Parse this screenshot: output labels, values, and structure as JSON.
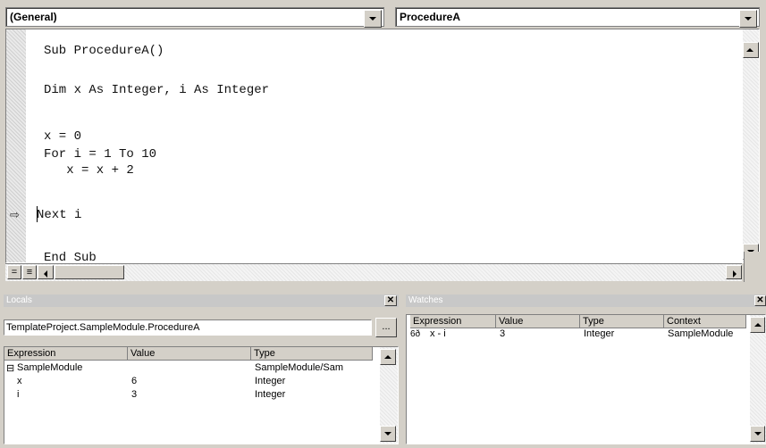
{
  "editor": {
    "object_combo": "(General)",
    "procedure_combo": "ProcedureA",
    "code_lines": [
      "Sub ProcedureA()",
      "Dim x As Integer, i As Integer",
      "x = 0",
      "For i = 1 To 10",
      "   x = x + 2",
      "Next i",
      "End Sub"
    ],
    "execution_arrow": "⇨"
  },
  "locals": {
    "title": "Locals",
    "context": "TemplateProject.SampleModule.ProcedureA",
    "ellipsis": "...",
    "columns": [
      "Expression",
      "Value",
      "Type"
    ],
    "rows": [
      {
        "expand": "⊟",
        "expression": "SampleModule",
        "value": "",
        "type": "SampleModule/Sam"
      },
      {
        "expand": "",
        "expression": "x",
        "value": "6",
        "type": "Integer"
      },
      {
        "expand": "",
        "expression": "i",
        "value": "3",
        "type": "Integer"
      }
    ]
  },
  "watches": {
    "title": "Watches",
    "columns": [
      "Expression",
      "Value",
      "Type",
      "Context"
    ],
    "rows": [
      {
        "icon": "6ð",
        "expression": "x - i",
        "value": "3",
        "type": "Integer",
        "context": "SampleModule"
      }
    ]
  }
}
